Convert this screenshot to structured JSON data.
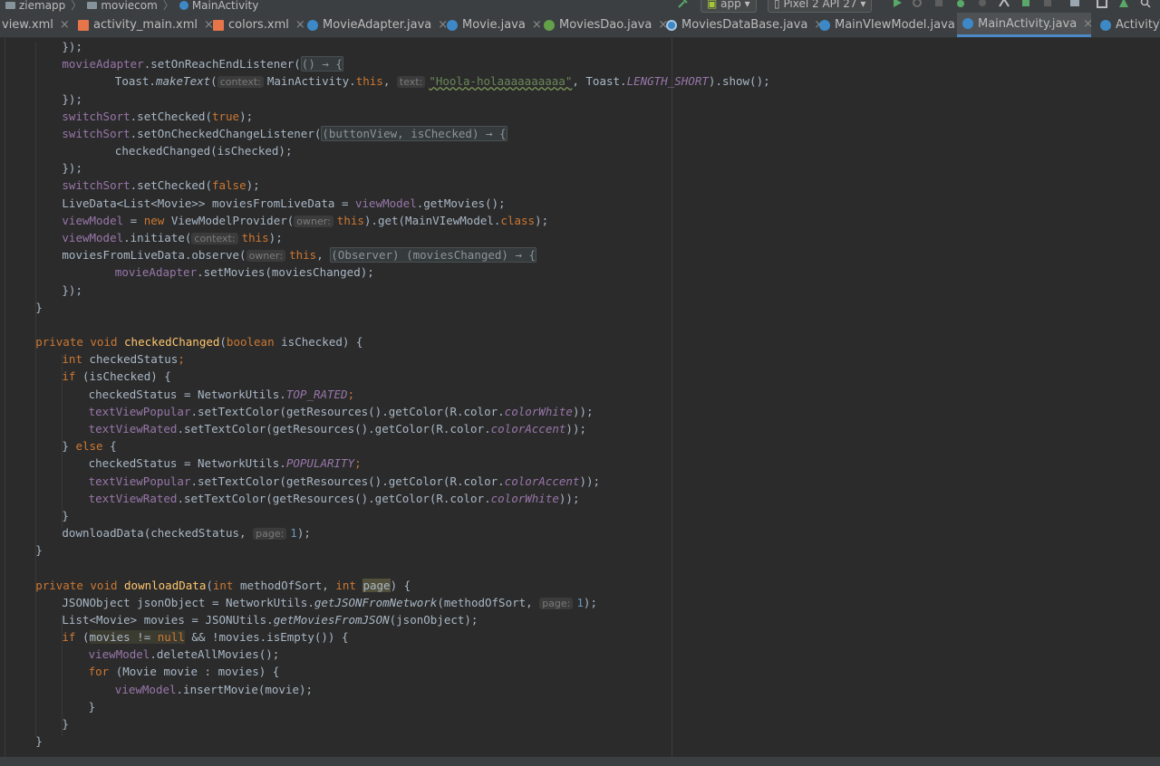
{
  "navbar": {
    "breadcrumbs": [
      "ziemapp",
      "moviecom",
      "MainActivity"
    ],
    "run_config": "app",
    "device": "Pixel 2 API 27"
  },
  "tabs": [
    {
      "label": "view.xml",
      "type": "xml",
      "active": false
    },
    {
      "label": "activity_main.xml",
      "type": "xml",
      "active": false
    },
    {
      "label": "colors.xml",
      "type": "xml",
      "active": false
    },
    {
      "label": "MovieAdapter.java",
      "type": "java",
      "active": false
    },
    {
      "label": "Movie.java",
      "type": "java",
      "active": false
    },
    {
      "label": "MoviesDao.java",
      "type": "dao",
      "active": false
    },
    {
      "label": "MoviesDataBase.java",
      "type": "db",
      "active": false
    },
    {
      "label": "MainVIewModel.java",
      "type": "java",
      "active": false
    },
    {
      "label": "MainActivity.java",
      "type": "java",
      "active": true
    },
    {
      "label": "ActivityT",
      "type": "java",
      "active": false
    }
  ],
  "editor": {
    "lines": [
      {
        "indent": 2,
        "tokens": [
          [
            "",
            "});"
          ]
        ]
      },
      {
        "indent": 2,
        "tokens": [
          [
            "fld",
            "movieAdapter"
          ],
          [
            "",
            ".setOnReachEndListener("
          ],
          [
            "lam",
            "() → {"
          ]
        ]
      },
      {
        "indent": 4,
        "tokens": [
          [
            "",
            "Toast."
          ],
          [
            "it",
            "makeText"
          ],
          [
            "",
            "("
          ],
          [
            "hint",
            "context:"
          ],
          [
            "",
            "MainActivity."
          ],
          [
            "kw",
            "this"
          ],
          [
            "",
            ", "
          ],
          [
            "hint",
            "text:"
          ],
          [
            "strw",
            "\"Hoola-holaaaaaaaaaa\""
          ],
          [
            "",
            ", Toast."
          ],
          [
            "cst",
            "LENGTH_SHORT"
          ],
          [
            "",
            ").show();"
          ]
        ]
      },
      {
        "indent": 2,
        "tokens": [
          [
            "",
            "});"
          ]
        ]
      },
      {
        "indent": 2,
        "tokens": [
          [
            "fld",
            "switchSort"
          ],
          [
            "",
            ".setChecked("
          ],
          [
            "kw",
            "true"
          ],
          [
            "",
            ");"
          ]
        ]
      },
      {
        "indent": 2,
        "tokens": [
          [
            "fld",
            "switchSort"
          ],
          [
            "",
            ".setOnCheckedChangeListener("
          ],
          [
            "lam",
            "(buttonView, isChecked) → {"
          ]
        ]
      },
      {
        "indent": 4,
        "tokens": [
          [
            "",
            "checkedChanged(isChecked);"
          ]
        ]
      },
      {
        "indent": 2,
        "tokens": [
          [
            "",
            "});"
          ]
        ]
      },
      {
        "indent": 2,
        "tokens": [
          [
            "fld",
            "switchSort"
          ],
          [
            "",
            ".setChecked("
          ],
          [
            "kw",
            "false"
          ],
          [
            "",
            ");"
          ]
        ]
      },
      {
        "indent": 2,
        "tokens": [
          [
            "",
            "LiveData<List<Movie>> moviesFromLiveData = "
          ],
          [
            "fld",
            "viewModel"
          ],
          [
            "",
            ".getMovies();"
          ]
        ]
      },
      {
        "indent": 2,
        "tokens": [
          [
            "fld",
            "viewModel"
          ],
          [
            "",
            " = "
          ],
          [
            "kw",
            "new "
          ],
          [
            "",
            "ViewModelProvider("
          ],
          [
            "hint",
            "owner:"
          ],
          [
            "kw",
            "this"
          ],
          [
            "",
            ").get(MainVIewModel."
          ],
          [
            "kw",
            "class"
          ],
          [
            "",
            ");"
          ]
        ]
      },
      {
        "indent": 2,
        "tokens": [
          [
            "fld",
            "viewModel"
          ],
          [
            "",
            ".initiate("
          ],
          [
            "hint",
            "context:"
          ],
          [
            "kw",
            "this"
          ],
          [
            "",
            ");"
          ]
        ]
      },
      {
        "indent": 2,
        "tokens": [
          [
            "",
            "moviesFromLiveData.observe("
          ],
          [
            "hint",
            "owner:"
          ],
          [
            "kw",
            "this"
          ],
          [
            "",
            ", "
          ],
          [
            "lam",
            "(Observer) (moviesChanged) → {"
          ]
        ]
      },
      {
        "indent": 4,
        "tokens": [
          [
            "fld",
            "movieAdapter"
          ],
          [
            "",
            ".setMovies(moviesChanged);"
          ]
        ]
      },
      {
        "indent": 2,
        "tokens": [
          [
            "",
            "});"
          ]
        ]
      },
      {
        "indent": 1,
        "tokens": [
          [
            "",
            "}"
          ]
        ]
      },
      {
        "indent": 0,
        "tokens": []
      },
      {
        "indent": 1,
        "tokens": [
          [
            "kw",
            "private void "
          ],
          [
            "fn",
            "checkedChanged"
          ],
          [
            "",
            "("
          ],
          [
            "kw",
            "boolean "
          ],
          [
            "",
            "isChecked) {"
          ]
        ]
      },
      {
        "indent": 2,
        "tokens": [
          [
            "kw",
            "int "
          ],
          [
            "",
            "checkedStatus"
          ],
          [
            "kw",
            ";"
          ]
        ]
      },
      {
        "indent": 2,
        "tokens": [
          [
            "kw",
            "if "
          ],
          [
            "",
            "(isChecked) {"
          ]
        ]
      },
      {
        "indent": 3,
        "tokens": [
          [
            "",
            "checkedStatus = NetworkUtils."
          ],
          [
            "cst",
            "TOP_RATED"
          ],
          [
            "kw",
            ";"
          ]
        ]
      },
      {
        "indent": 3,
        "tokens": [
          [
            "fld",
            "textViewPopular"
          ],
          [
            "",
            ".setTextColor(getResources().getColor(R.color."
          ],
          [
            "cst",
            "colorWhite"
          ],
          [
            "",
            "));"
          ]
        ]
      },
      {
        "indent": 3,
        "tokens": [
          [
            "fld",
            "textViewRated"
          ],
          [
            "",
            ".setTextColor(getResources().getColor(R.color."
          ],
          [
            "cst",
            "colorAccent"
          ],
          [
            "",
            "));"
          ]
        ]
      },
      {
        "indent": 2,
        "tokens": [
          [
            "",
            "} "
          ],
          [
            "kw",
            "else "
          ],
          [
            "",
            "{"
          ]
        ]
      },
      {
        "indent": 3,
        "tokens": [
          [
            "",
            "checkedStatus = NetworkUtils."
          ],
          [
            "cst",
            "POPULARITY"
          ],
          [
            "kw",
            ";"
          ]
        ]
      },
      {
        "indent": 3,
        "tokens": [
          [
            "fld",
            "textViewPopular"
          ],
          [
            "",
            ".setTextColor(getResources().getColor(R.color."
          ],
          [
            "cst",
            "colorAccent"
          ],
          [
            "",
            "));"
          ]
        ]
      },
      {
        "indent": 3,
        "tokens": [
          [
            "fld",
            "textViewRated"
          ],
          [
            "",
            ".setTextColor(getResources().getColor(R.color."
          ],
          [
            "cst",
            "colorWhite"
          ],
          [
            "",
            "));"
          ]
        ]
      },
      {
        "indent": 2,
        "tokens": [
          [
            "",
            "}"
          ]
        ]
      },
      {
        "indent": 2,
        "tokens": [
          [
            "",
            "downloadData(checkedStatus, "
          ],
          [
            "hint",
            "page:"
          ],
          [
            "num",
            "1"
          ],
          [
            "",
            ");"
          ]
        ]
      },
      {
        "indent": 1,
        "tokens": [
          [
            "",
            "}"
          ]
        ]
      },
      {
        "indent": 0,
        "tokens": []
      },
      {
        "indent": 1,
        "tokens": [
          [
            "kw",
            "private void "
          ],
          [
            "fn",
            "downloadData"
          ],
          [
            "",
            "("
          ],
          [
            "kw",
            "int "
          ],
          [
            "",
            "methodOfSort, "
          ],
          [
            "kw",
            "int "
          ],
          [
            "hlu",
            "page"
          ],
          [
            "",
            ") {"
          ]
        ]
      },
      {
        "indent": 2,
        "tokens": [
          [
            "",
            "JSONObject jsonObject = NetworkUtils."
          ],
          [
            "it",
            "getJSONFromNetwork"
          ],
          [
            "",
            "(methodOfSort, "
          ],
          [
            "hint",
            "page:"
          ],
          [
            "num",
            "1"
          ],
          [
            "",
            ");"
          ]
        ]
      },
      {
        "indent": 2,
        "tokens": [
          [
            "",
            "List<Movie> movies = JSONUtils."
          ],
          [
            "it",
            "getMoviesFromJSON"
          ],
          [
            "",
            "(jsonObject);"
          ]
        ]
      },
      {
        "indent": 2,
        "tokens": [
          [
            "kw",
            "if "
          ],
          [
            "",
            "("
          ],
          [
            "hl",
            "movies != "
          ],
          [
            "hlk",
            "null"
          ],
          [
            "",
            " && !movies.isEmpty()) {"
          ]
        ]
      },
      {
        "indent": 3,
        "tokens": [
          [
            "fld",
            "viewModel"
          ],
          [
            "",
            ".deleteAllMovies();"
          ]
        ]
      },
      {
        "indent": 3,
        "tokens": [
          [
            "kw",
            "for "
          ],
          [
            "",
            "(Movie movie : movies) {"
          ]
        ]
      },
      {
        "indent": 4,
        "tokens": [
          [
            "fld",
            "viewModel"
          ],
          [
            "",
            ".insertMovie(movie);"
          ]
        ]
      },
      {
        "indent": 3,
        "tokens": [
          [
            "",
            "}"
          ]
        ]
      },
      {
        "indent": 2,
        "tokens": [
          [
            "",
            "}"
          ]
        ]
      },
      {
        "indent": 1,
        "tokens": [
          [
            "",
            "}"
          ]
        ]
      }
    ]
  },
  "colors": {
    "background": "#2b2b2b",
    "keyword": "#cc7832",
    "field": "#9876aa",
    "method_decl": "#ffc66d",
    "string": "#6a8759",
    "number": "#6897bb",
    "active_tab_underline": "#4a88c7"
  },
  "icons": {
    "folder": "folder-icon",
    "run": "run-icon",
    "debug": "debug-icon",
    "device": "device-icon"
  }
}
